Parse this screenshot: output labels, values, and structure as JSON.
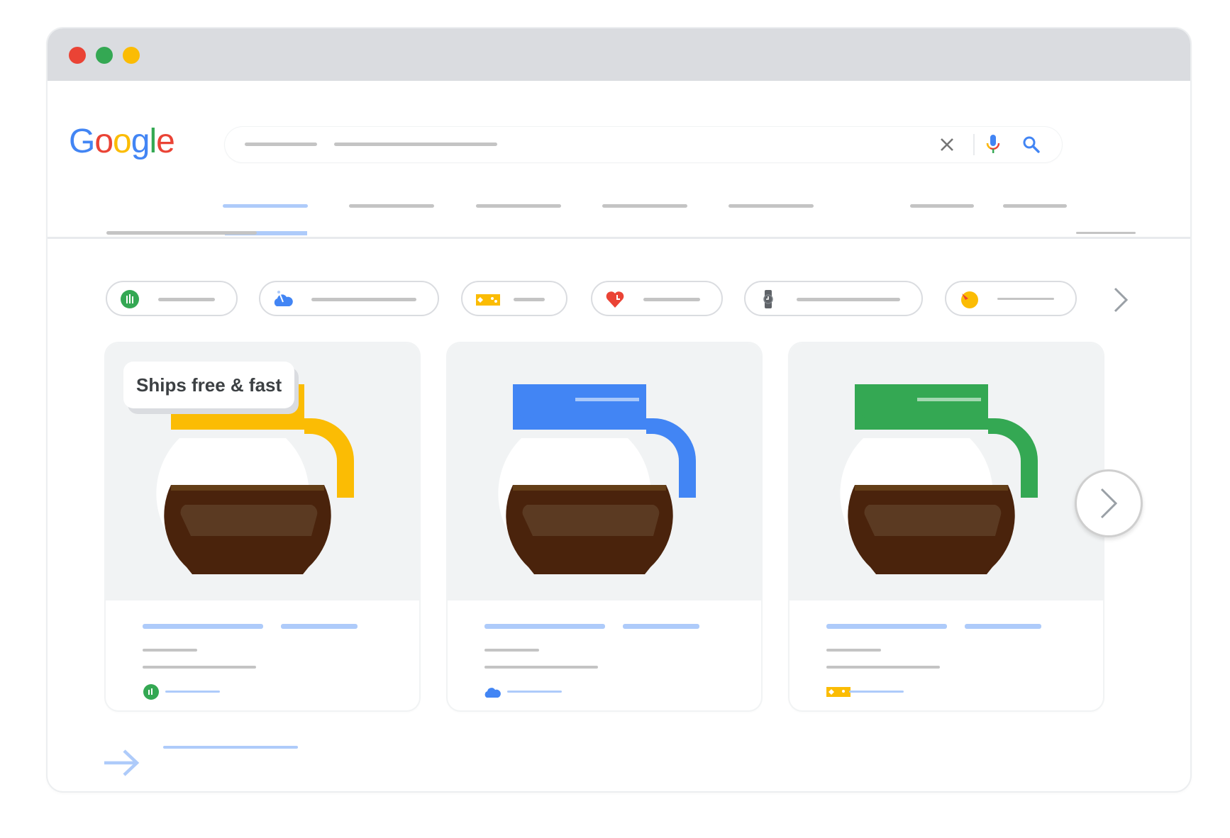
{
  "window": {
    "traffic_lights": [
      {
        "name": "close",
        "color": "#ea4335"
      },
      {
        "name": "minimize",
        "color": "#34a853"
      },
      {
        "name": "maximize",
        "color": "#fbbc04"
      }
    ]
  },
  "header": {
    "logo": {
      "letters": [
        {
          "char": "G",
          "color": "#4285f4"
        },
        {
          "char": "o",
          "color": "#ea4335"
        },
        {
          "char": "o",
          "color": "#fbbc04"
        },
        {
          "char": "g",
          "color": "#4285f4"
        },
        {
          "char": "l",
          "color": "#34a853"
        },
        {
          "char": "e",
          "color": "#ea4335"
        }
      ]
    },
    "search": {
      "query_placeholder_bars": 2,
      "icons": [
        "clear-icon",
        "microphone-icon",
        "search-icon"
      ]
    },
    "tabs": {
      "count": 7,
      "active_index": 0
    }
  },
  "chips": [
    {
      "icon": "eco-leaf-icon",
      "color": "#34a853"
    },
    {
      "icon": "cloud-icon",
      "color": "#4285f4"
    },
    {
      "icon": "ticket-icon",
      "color": "#fbbc04"
    },
    {
      "icon": "heart-icon",
      "color": "#ea4335"
    },
    {
      "icon": "watch-icon",
      "color": "#5f6368"
    },
    {
      "icon": "pizza-icon",
      "color": "#fbbc04"
    }
  ],
  "cards": [
    {
      "badge": "Ships free & fast",
      "accent": "#fbbc04",
      "seller_icon": "eco-leaf-icon"
    },
    {
      "badge": null,
      "accent": "#4285f4",
      "seller_icon": "cloud-icon"
    },
    {
      "badge": null,
      "accent": "#34a853",
      "seller_icon": "ticket-icon"
    }
  ],
  "colors": {
    "coffee_dark": "#4a230c",
    "coffee_light": "#5b3a22",
    "placeholder_gray": "#c4c4c4",
    "placeholder_blue": "#aecbfa"
  }
}
